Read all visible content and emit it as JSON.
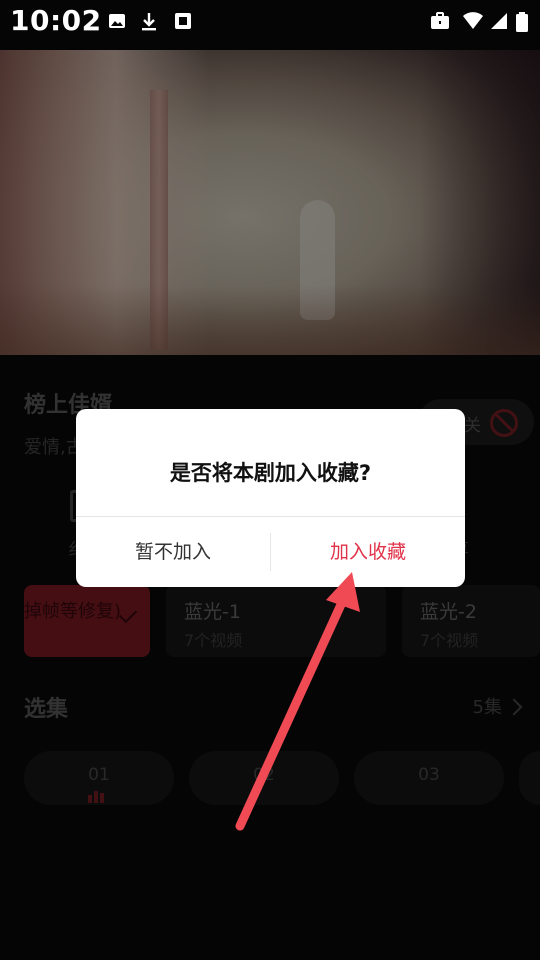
{
  "status_bar": {
    "time": "10:02"
  },
  "drama": {
    "title": "榜上佳婿",
    "tags": "爱情,古",
    "toggle_label": "关"
  },
  "actions": [
    {
      "label": "纟"
    },
    {
      "label": "享"
    }
  ],
  "quality": {
    "selected_text": "掉帧等修复)",
    "options": [
      {
        "name": "蓝光-1",
        "sub": "7个视频"
      },
      {
        "name": "蓝光-2",
        "sub": "7个视频"
      }
    ]
  },
  "episodes": {
    "section_title": "选集",
    "count_label": "5集",
    "items": [
      {
        "label": "01",
        "playing": true
      },
      {
        "label": "02",
        "playing": false
      },
      {
        "label": "03",
        "playing": false
      }
    ]
  },
  "dialog": {
    "message": "是否将本剧加入收藏?",
    "negative_label": "暂不加入",
    "positive_label": "加入收藏"
  },
  "colors": {
    "accent": "#e0334a",
    "selected_quality": "#7c1a23"
  }
}
